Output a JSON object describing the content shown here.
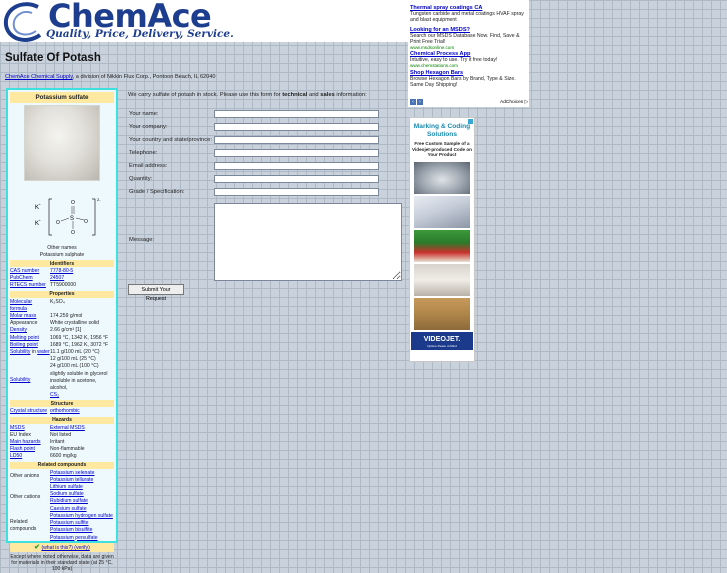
{
  "header": {
    "logo": "ChemAce",
    "tagline": "Quality, Price, Delivery, Service."
  },
  "page": {
    "title": "Sulfate Of Potash",
    "company_link": "ChemAce Chemical Supply",
    "company_rest": ", a division of Nikkin Flux Corp., Pontoon Beach, IL 62040"
  },
  "infobox": {
    "title": "Potassium sulfate",
    "other_names_label": "Other names",
    "other_names_value": "Potassium sulphate",
    "struct_k1": "K",
    "struct_k2": "K",
    "identifiers": {
      "heading": "Identifiers",
      "rows": [
        {
          "k": "CAS number",
          "v": "7778-80-5",
          "kl": true,
          "vl": true
        },
        {
          "k": "PubChem",
          "v": "24507",
          "kl": true,
          "vl": true
        },
        {
          "k": "RTECS number",
          "v": "TT5900000",
          "kl": true,
          "vl": false
        }
      ]
    },
    "properties": {
      "heading": "Properties",
      "rows": [
        {
          "k": "Molecular formula",
          "v": "K₂SO₄",
          "kl": true,
          "vl": false
        },
        {
          "k": "Molar mass",
          "v": "174.259 g/mol",
          "kl": true,
          "vl": false
        },
        {
          "k": "Appearance",
          "v": "White crystalline solid",
          "kl": false,
          "vl": false
        },
        {
          "k": "Density",
          "v": "2.66 g/cm³ [1]",
          "kl": true,
          "vl": false
        },
        {
          "k": "Melting point",
          "v": "1069 °C, 1342 K, 1956 °F",
          "kl": true,
          "vl": false
        },
        {
          "k": "Boiling point",
          "v": "1689 °C, 1962 K, 3072 °F",
          "kl": true,
          "vl": false
        }
      ],
      "solubility_water_label_1": "Solubility",
      "solubility_water_label_2": "in",
      "solubility_water_label_3": "water",
      "solubility_water_values": [
        "11.1 g/100 mL (20 °C)",
        "12 g/100 mL (25 °C)",
        "24 g/100 mL (100 °C)"
      ],
      "solubility_label": "Solubility",
      "solubility_values": [
        "slightly soluble in glycerol",
        "insoluble in acetone, alcohol,",
        "CS₂"
      ]
    },
    "structure": {
      "heading": "Structure",
      "k": "Crystal structure",
      "v": "orthorhombic"
    },
    "hazards": {
      "heading": "Hazards",
      "rows": [
        {
          "k": "MSDS",
          "v": "External MSDS",
          "kl": true,
          "vl": true
        },
        {
          "k": "EU Index",
          "v": "Not listed",
          "kl": false,
          "vl": false
        },
        {
          "k": "Main hazards",
          "v": "Irritant",
          "kl": true,
          "vl": false
        },
        {
          "k": "Flash point",
          "v": "Non-flammable",
          "kl": true,
          "vl": false
        },
        {
          "k": "LD50",
          "v": "6600 mg/kg",
          "kl": true,
          "vl": false
        }
      ]
    },
    "related": {
      "heading": "Related compounds",
      "other_anions_label": "Other anions",
      "other_anions": [
        "Potassium selenate",
        "Potassium tellurate"
      ],
      "other_cations_label": "Other cations",
      "other_cations": [
        "Lithium sulfate",
        "Sodium sulfate",
        "Rubidium sulfate",
        "Caesium sulfate"
      ],
      "related_label": "Related compounds",
      "related": [
        "Potassium hydrogen sulfate",
        "Potassium sulfite",
        "Potassium bisulfite",
        "Potassium persulfate"
      ]
    },
    "verify": "(what is this?)  (verify)",
    "footer": "Except where noted otherwise, data are given for materials in their standard state (at 25 °C, 100 kPa)"
  },
  "form": {
    "intro_1": "We carry sulfate of potash in stock. Please use this form for ",
    "intro_b1": "technical",
    "intro_2": " and ",
    "intro_b2": "sales",
    "intro_3": " information:",
    "fields": [
      "Your name:",
      "Your company:",
      "Your country and state/province:",
      "Telephone:",
      "Email address:",
      "Quantity:",
      "Grade / Specification:"
    ],
    "message_label": "Message:",
    "submit": "Submit Your Request"
  },
  "ads": {
    "items": [
      {
        "title": "Thermal spray coatings CA",
        "desc": "Tungsten carbide and metal coatings HVAF spray and blast equipment",
        "url": ""
      },
      {
        "title": "Looking for an MSDS?",
        "desc": "Search our MSDS Database Now. Find, Save & Print Free Trial!",
        "url": "www.msdsonline.com"
      },
      {
        "title": "Chemical Process App",
        "desc": "Intuitive, easy to use. Try it free today!",
        "url": "www.chemstations.com"
      },
      {
        "title": "Shop Hexagon Bars",
        "desc": "Browse Hexagon Bars by Brand, Type & Size. Same Day Shipping!",
        "url": ""
      }
    ],
    "adchoices": "AdChoices ▷"
  },
  "banner": {
    "title": "Marking & Coding Solutions",
    "subtitle": "Free Custom Sample of a Videojet-produced Code on Your Product",
    "logo": "VIDEOJET.",
    "logo_sub": "Uptime Peace of Mind"
  }
}
